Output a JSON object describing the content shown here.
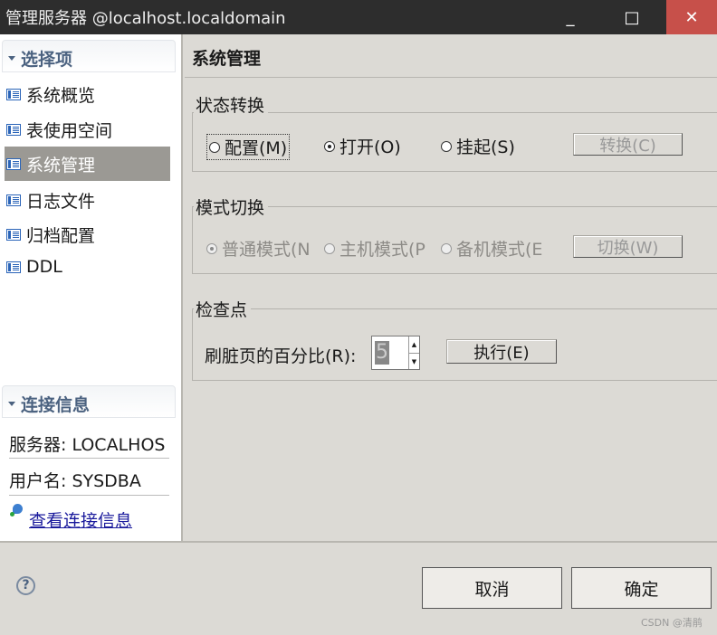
{
  "window": {
    "title": "管理服务器  @localhost.localdomain",
    "minimize": "_",
    "maximize": "□",
    "close": "✕",
    "close_bg": "#c7504a"
  },
  "sidebar": {
    "options_header": "选择项",
    "items": [
      {
        "label": "系统概览"
      },
      {
        "label": "表使用空间"
      },
      {
        "label": "系统管理",
        "selected": true
      },
      {
        "label": "日志文件"
      },
      {
        "label": "归档配置"
      },
      {
        "label": "DDL"
      }
    ],
    "connection_header": "连接信息",
    "server": "服务器: LOCALHOS",
    "user": "用户名: SYSDBA",
    "view_link": "查看连接信息"
  },
  "main": {
    "title": "系统管理",
    "state": {
      "legend": "状态转换",
      "options": [
        {
          "label": "配置(M)",
          "checked": false
        },
        {
          "label": "打开(O)",
          "checked": true
        },
        {
          "label": "挂起(S)",
          "checked": false
        }
      ],
      "button": "转换(C)"
    },
    "mode": {
      "legend": "模式切换",
      "options": [
        {
          "label": "普通模式(N",
          "checked": true
        },
        {
          "label": "主机模式(P",
          "checked": false
        },
        {
          "label": "备机模式(E",
          "checked": false
        }
      ],
      "button": "切换(W)"
    },
    "checkpoint": {
      "legend": "检查点",
      "label": "刷脏页的百分比(R):",
      "value": "5",
      "button": "执行(E)"
    }
  },
  "footer": {
    "help": "?",
    "cancel": "取消",
    "ok": "确定",
    "watermark": "CSDN @清鹃"
  }
}
